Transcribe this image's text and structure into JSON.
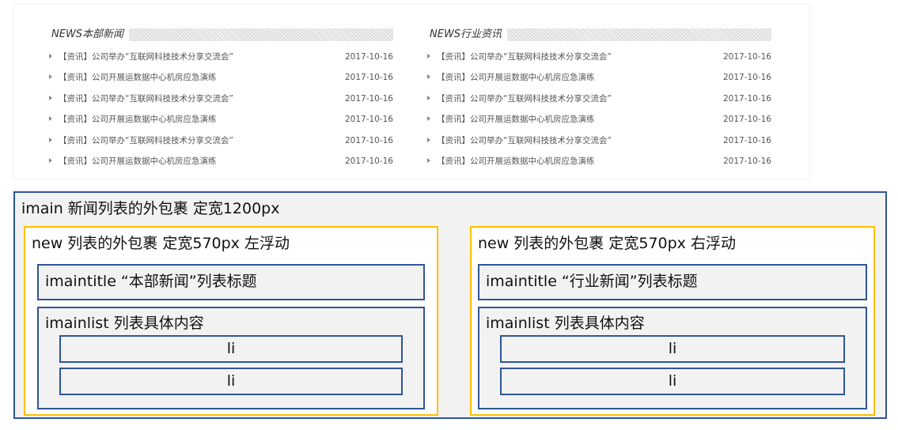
{
  "preview": {
    "columns": [
      {
        "title": "NEWS本部新闻",
        "items": [
          {
            "title": "【资讯】公司举办“互联网科技技术分享交流会”",
            "date": "2017-10-16"
          },
          {
            "title": "【资讯】公司开展运数据中心机房应急演练",
            "date": "2017-10-16"
          },
          {
            "title": "【资讯】公司举办“互联网科技技术分享交流会”",
            "date": "2017-10-16"
          },
          {
            "title": "【资讯】公司开展运数据中心机房应急演练",
            "date": "2017-10-16"
          },
          {
            "title": "【资讯】公司举办“互联网科技技术分享交流会”",
            "date": "2017-10-16"
          },
          {
            "title": "【资讯】公司开展运数据中心机房应急演练",
            "date": "2017-10-16"
          }
        ]
      },
      {
        "title": "NEWS行业资讯",
        "items": [
          {
            "title": "【资讯】公司举办“互联网科技技术分享交流会”",
            "date": "2017-10-16"
          },
          {
            "title": "【资讯】公司开展运数据中心机房应急演练",
            "date": "2017-10-16"
          },
          {
            "title": "【资讯】公司举办“互联网科技技术分享交流会”",
            "date": "2017-10-16"
          },
          {
            "title": "【资讯】公司开展运数据中心机房应急演练",
            "date": "2017-10-16"
          },
          {
            "title": "【资讯】公司举办“互联网科技技术分享交流会”",
            "date": "2017-10-16"
          },
          {
            "title": "【资讯】公司开展运数据中心机房应急演练",
            "date": "2017-10-16"
          }
        ]
      }
    ]
  },
  "diagram": {
    "imain_label": "imain  新闻列表的外包裹  定宽1200px",
    "boxes": [
      {
        "new_label": "new  列表的外包裹  定宽570px  左浮动",
        "title_label": "imaintitle “本部新闻”列表标题",
        "list_label": "imainlist  列表具体内容",
        "li_labels": [
          "li",
          "li"
        ]
      },
      {
        "new_label": "new  列表的外包裹  定宽570px  右浮动",
        "title_label": "imaintitle “行业新闻”列表标题",
        "list_label": "imainlist  列表具体内容",
        "li_labels": [
          "li",
          "li"
        ]
      }
    ]
  },
  "colors": {
    "blue_border": "#2f5597",
    "orange_border": "#ffc000",
    "box_fill": "#f2f2f2"
  }
}
